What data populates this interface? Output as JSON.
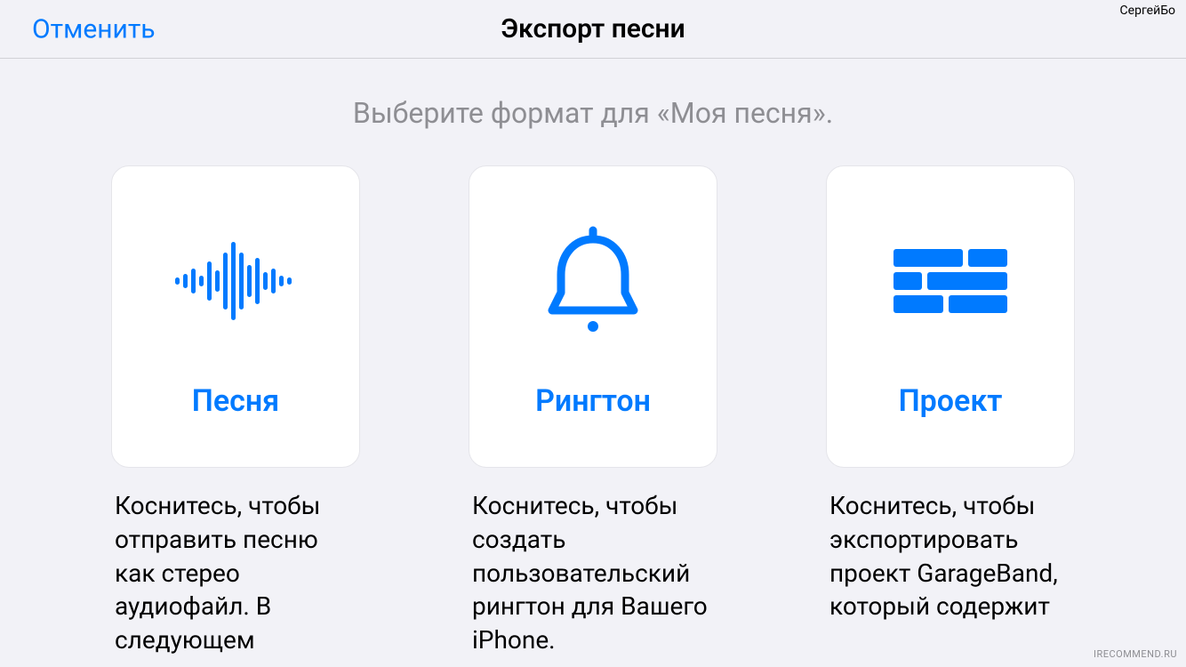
{
  "header": {
    "cancel_label": "Отменить",
    "title": "Экспорт песни"
  },
  "username": "СергейБо",
  "subtitle": "Выберите формат для «Моя песня».",
  "options": {
    "song": {
      "title": "Песня",
      "description": "Коснитесь, чтобы отправить песню как стерео аудиофайл. В следующем"
    },
    "ringtone": {
      "title": "Рингтон",
      "description": "Коснитесь, чтобы создать пользовательский рингтон для Вашего iPhone."
    },
    "project": {
      "title": "Проект",
      "description": "Коснитесь, чтобы экспортировать проект GarageBand, который содержит"
    }
  },
  "watermark": "IRECOMMEND.RU"
}
